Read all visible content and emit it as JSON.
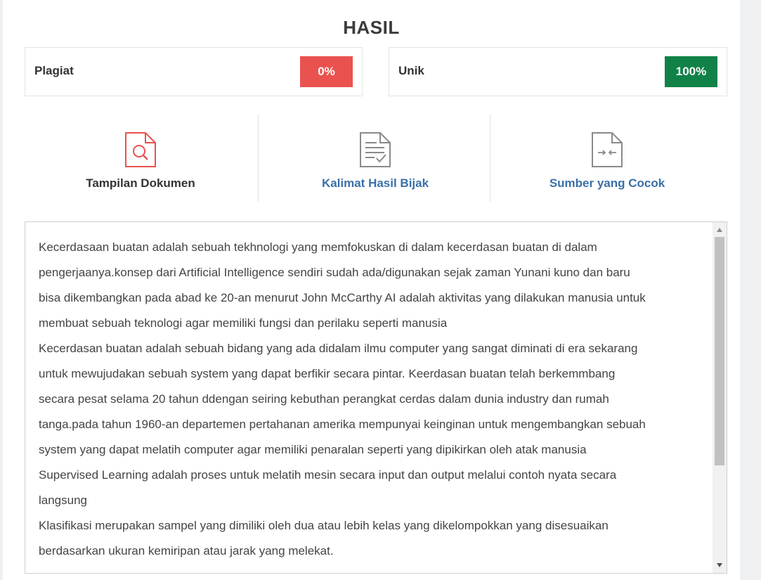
{
  "header": {
    "title": "HASIL"
  },
  "scores": {
    "plagiarism": {
      "label": "Plagiat",
      "value": "0%",
      "color": "#e9524f"
    },
    "unique": {
      "label": "Unik",
      "value": "100%",
      "color": "#118247"
    }
  },
  "tabs": [
    {
      "label": "Tampilan Dokumen",
      "icon": "document-search-icon",
      "color": "#e9524f"
    },
    {
      "label": "Kalimat Hasil Bijak",
      "icon": "document-check-icon",
      "color": "#3a70a8"
    },
    {
      "label": "Sumber yang Cocok",
      "icon": "document-compare-icon",
      "color": "#3a70a8"
    }
  ],
  "document": {
    "lines": [
      "Kecerdasaan buatan adalah sebuah tekhnologi yang memfokuskan di dalam kecerdasan buatan di dalam",
      "pengerjaanya.konsep dari Artificial Intelligence sendiri sudah ada/digunakan sejak zaman Yunani kuno dan baru",
      "bisa dikembangkan pada abad ke 20-an menurut John McCarthy AI adalah aktivitas yang dilakukan manusia untuk",
      "membuat sebuah teknologi agar memiliki fungsi dan perilaku seperti manusia",
      "Kecerdasan buatan adalah sebuah bidang yang ada didalam ilmu computer yang sangat diminati di era sekarang",
      "untuk mewujudakan sebuah system yang dapat berfikir secara pintar. Keerdasan buatan telah berkemmbang",
      "secara pesat selama 20 tahun ddengan seiring kebuthan perangkat cerdas dalam dunia industry dan rumah",
      "tanga.pada tahun 1960-an departemen pertahanan amerika mempunyai keinginan untuk mengembangkan sebuah",
      "system yang dapat melatih computer agar memiliki penaralan seperti yang dipikirkan oleh atak manusia",
      "Supervised Learning adalah proses untuk melatih mesin secara input dan output melalui contoh nyata secara",
      "langsung",
      "Klasifikasi merupakan sampel yang dimiliki oleh dua atau lebih kelas yang dikelompokkan yang disesuaikan",
      "berdasarkan ukuran kemiripan atau jarak yang melekat."
    ]
  }
}
